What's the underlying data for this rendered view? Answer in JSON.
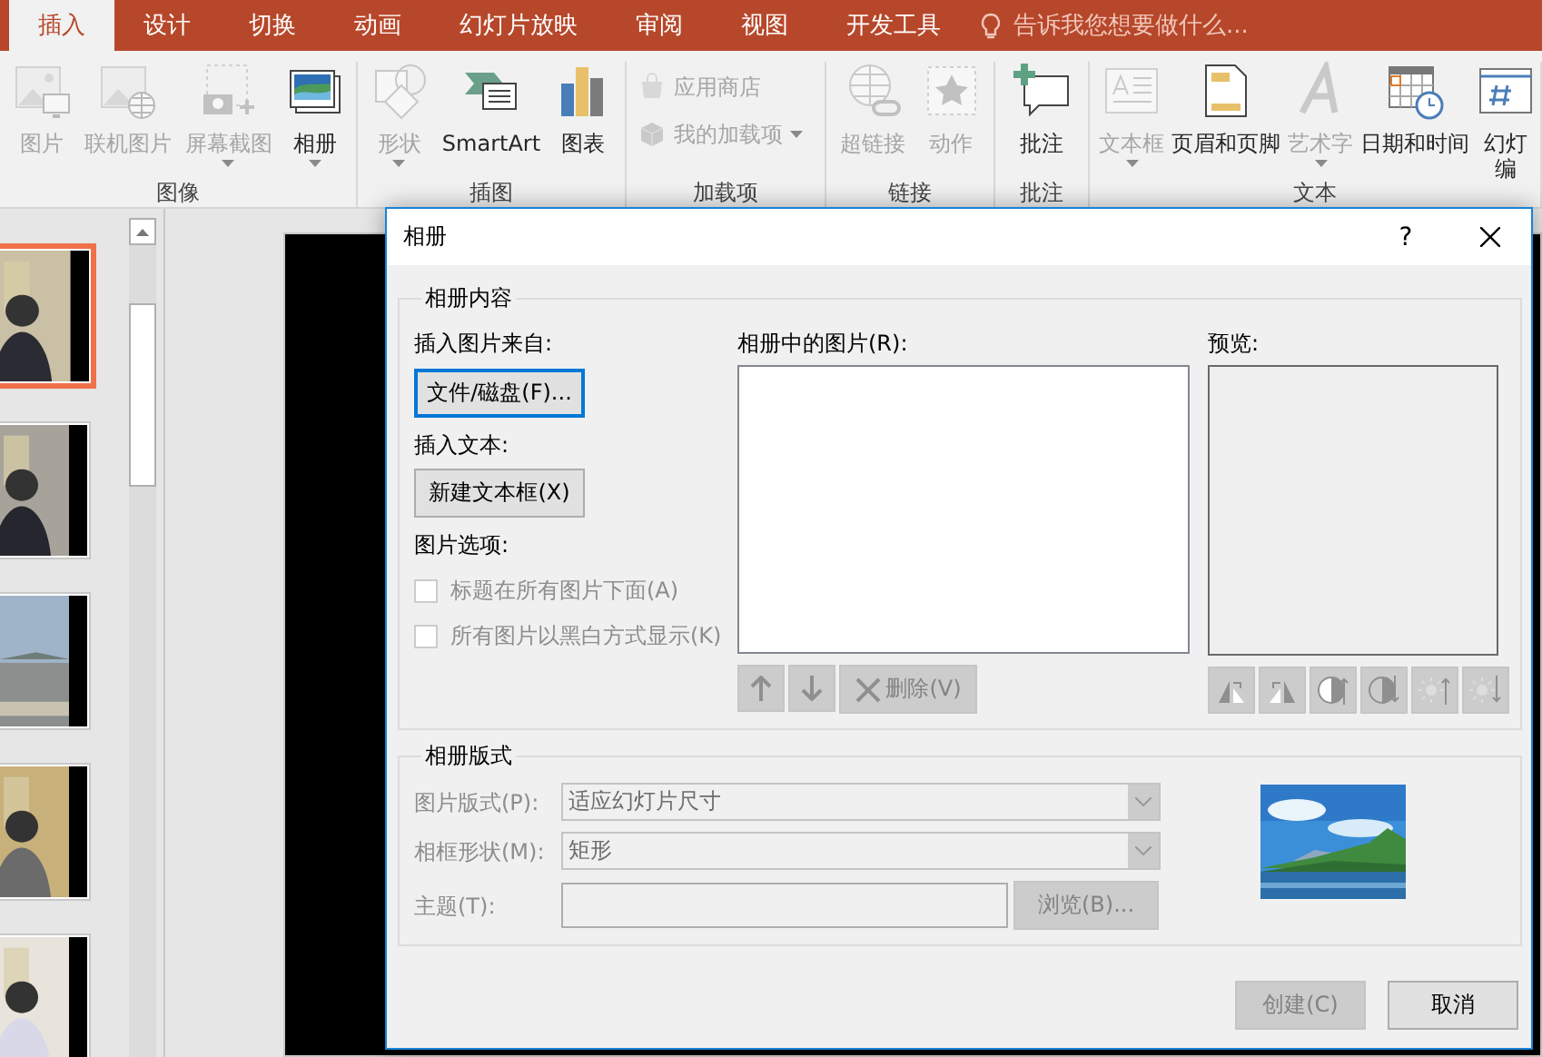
{
  "tabs": [
    {
      "label": "插入",
      "selected": true
    },
    {
      "label": "设计",
      "selected": false
    },
    {
      "label": "切换",
      "selected": false
    },
    {
      "label": "动画",
      "selected": false
    },
    {
      "label": "幻灯片放映",
      "selected": false
    },
    {
      "label": "审阅",
      "selected": false
    },
    {
      "label": "视图",
      "selected": false
    },
    {
      "label": "开发工具",
      "selected": false
    }
  ],
  "tell_me": {
    "placeholder": "告诉我您想要做什么..."
  },
  "ribbon": {
    "groups": [
      {
        "label": "图像",
        "items": [
          {
            "kind": "large",
            "lines": [
              "图片"
            ],
            "disabled": true,
            "dropdown": false
          },
          {
            "kind": "large",
            "lines": [
              "联机图片"
            ],
            "disabled": true,
            "dropdown": false
          },
          {
            "kind": "large",
            "lines": [
              "屏幕截图"
            ],
            "disabled": true,
            "dropdown": true
          },
          {
            "kind": "large",
            "lines": [
              "相册"
            ],
            "disabled": false,
            "dropdown": true
          }
        ]
      },
      {
        "label": "插图",
        "items": [
          {
            "kind": "large",
            "lines": [
              "形状"
            ],
            "disabled": true,
            "dropdown": true
          },
          {
            "kind": "large",
            "lines": [
              "SmartArt"
            ],
            "disabled": false,
            "dropdown": false
          },
          {
            "kind": "large",
            "lines": [
              "图表"
            ],
            "disabled": false,
            "dropdown": false
          }
        ]
      },
      {
        "label": "加载项",
        "items": [
          {
            "kind": "small",
            "lines": [
              "应用商店"
            ],
            "disabled": true,
            "dropdown": false
          },
          {
            "kind": "small",
            "lines": [
              "我的加载项"
            ],
            "disabled": true,
            "dropdown": true
          }
        ]
      },
      {
        "label": "链接",
        "items": [
          {
            "kind": "large",
            "lines": [
              "超链接"
            ],
            "disabled": true,
            "dropdown": false
          },
          {
            "kind": "large",
            "lines": [
              "动作"
            ],
            "disabled": true,
            "dropdown": false
          }
        ]
      },
      {
        "label": "批注",
        "items": [
          {
            "kind": "large",
            "lines": [
              "批注"
            ],
            "disabled": false,
            "dropdown": false
          }
        ]
      },
      {
        "label": "文本",
        "items": [
          {
            "kind": "large",
            "lines": [
              "文本框"
            ],
            "disabled": true,
            "dropdown": true
          },
          {
            "kind": "large",
            "lines": [
              "页眉和页脚"
            ],
            "disabled": false,
            "dropdown": false
          },
          {
            "kind": "large",
            "lines": [
              "艺术字"
            ],
            "disabled": true,
            "dropdown": true
          },
          {
            "kind": "large",
            "lines": [
              "日期和时间"
            ],
            "disabled": false,
            "dropdown": false
          },
          {
            "kind": "large",
            "lines": [
              "幻灯",
              "编"
            ],
            "disabled": false,
            "dropdown": false
          }
        ]
      }
    ]
  },
  "slides": [
    {
      "kind": "picture",
      "selected": true
    },
    {
      "kind": "picture",
      "selected": false
    },
    {
      "kind": "picture",
      "selected": false
    },
    {
      "kind": "picture",
      "selected": false
    },
    {
      "kind": "picture",
      "selected": false
    }
  ],
  "dialog": {
    "title": "相册",
    "help": "?",
    "content": {
      "legend": "相册内容",
      "insert_from_label": "插入图片来自:",
      "file_button": {
        "label": "文件/磁盘(F)...",
        "focused": true
      },
      "insert_text_label": "插入文本:",
      "textbox_button": {
        "label": "新建文本框(X)",
        "focused": false
      },
      "options_label": "图片选项:",
      "options": [
        {
          "label": "标题在所有图片下面(A)",
          "checked": false,
          "disabled": true
        },
        {
          "label": "所有图片以黑白方式显示(K)",
          "checked": false,
          "disabled": true
        }
      ],
      "pictures_label": "相册中的图片(R):",
      "list_buttons": [
        {
          "kind": "up",
          "disabled": true
        },
        {
          "kind": "down",
          "disabled": true
        },
        {
          "kind": "delete",
          "label": "删除(V)",
          "disabled": true
        }
      ],
      "preview_label": "预览:",
      "preview_tools": [
        {
          "kind": "rotate_left",
          "disabled": true
        },
        {
          "kind": "rotate_right",
          "disabled": true
        },
        {
          "kind": "contrast_up",
          "disabled": true
        },
        {
          "kind": "contrast_down",
          "disabled": true
        },
        {
          "kind": "brightness_up",
          "disabled": true
        },
        {
          "kind": "brightness_down",
          "disabled": true
        }
      ]
    },
    "layout": {
      "legend": "相册版式",
      "fields": [
        {
          "kind": "select",
          "label": "图片版式(P):",
          "value": "适应幻灯片尺寸",
          "disabled": true
        },
        {
          "kind": "select",
          "label": "相框形状(M):",
          "value": "矩形",
          "disabled": true
        },
        {
          "kind": "theme",
          "label": "主题(T):",
          "button": "浏览(B)...",
          "disabled": true
        }
      ],
      "sample": {
        "kind": "picture"
      }
    },
    "buttons": [
      {
        "label": "创建(C)",
        "disabled": true
      },
      {
        "label": "取消",
        "disabled": false
      }
    ]
  }
}
